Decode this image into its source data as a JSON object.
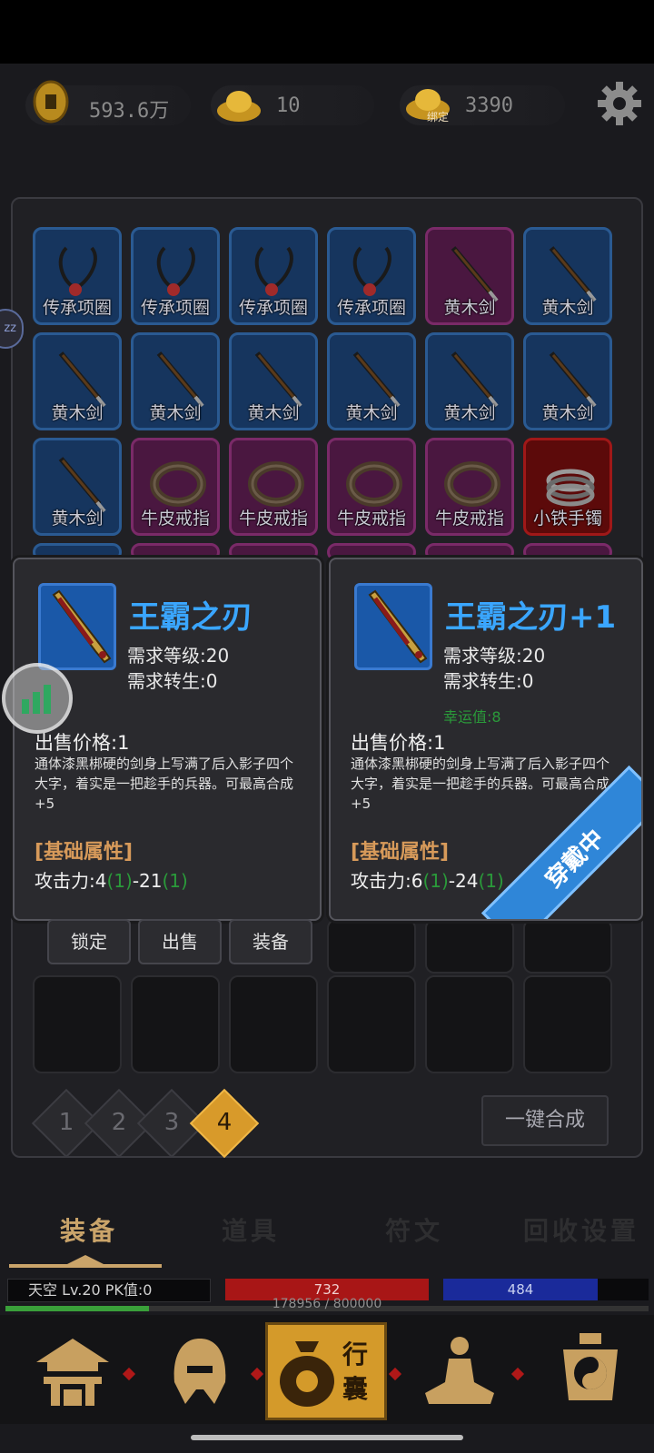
{
  "currency": {
    "copper": "593.6万",
    "gold": "10",
    "bound_gold": "3390",
    "bound_badge": "绑定"
  },
  "inventory": {
    "rows": [
      [
        {
          "label": "传承项圈",
          "color": "blue",
          "icon": "necklace-icon"
        },
        {
          "label": "传承项圈",
          "color": "blue",
          "icon": "necklace-icon"
        },
        {
          "label": "传承项圈",
          "color": "blue",
          "icon": "necklace-icon"
        },
        {
          "label": "传承项圈",
          "color": "blue",
          "icon": "necklace-icon"
        },
        {
          "label": "黄木剑",
          "color": "purple",
          "icon": "sword-icon"
        },
        {
          "label": "黄木剑",
          "color": "blue",
          "icon": "sword-icon"
        }
      ],
      [
        {
          "label": "黄木剑",
          "color": "blue",
          "icon": "sword-icon"
        },
        {
          "label": "黄木剑",
          "color": "blue",
          "icon": "sword-icon"
        },
        {
          "label": "黄木剑",
          "color": "blue",
          "icon": "sword-icon"
        },
        {
          "label": "黄木剑",
          "color": "blue",
          "icon": "sword-icon"
        },
        {
          "label": "黄木剑",
          "color": "blue",
          "icon": "sword-icon"
        },
        {
          "label": "黄木剑",
          "color": "blue",
          "icon": "sword-icon"
        }
      ],
      [
        {
          "label": "黄木剑",
          "color": "blue",
          "icon": "sword-icon"
        },
        {
          "label": "牛皮戒指",
          "color": "purple",
          "icon": "ring-icon"
        },
        {
          "label": "牛皮戒指",
          "color": "purple",
          "icon": "ring-icon"
        },
        {
          "label": "牛皮戒指",
          "color": "purple",
          "icon": "ring-icon"
        },
        {
          "label": "牛皮戒指",
          "color": "purple",
          "icon": "ring-icon"
        },
        {
          "label": "小铁手镯",
          "color": "red",
          "icon": "bracelet-icon"
        }
      ]
    ]
  },
  "item_new": {
    "name": "王霸之刃",
    "req_level": "需求等级:20",
    "req_rebirth": "需求转生:0",
    "price": "出售价格:1",
    "desc": "通体漆黑梆硬的剑身上写满了后入影子四个大字，着实是一把趁手的兵器。可最高合成+5",
    "attr_title": "[基础属性]",
    "attack_prefix": "攻击力:4",
    "attack_bonus1": "(1)",
    "attack_mid": "-21",
    "attack_bonus2": "(1)"
  },
  "item_worn": {
    "name": "王霸之刃+1",
    "req_level": "需求等级:20",
    "req_rebirth": "需求转生:0",
    "luck": "幸运值:8",
    "price": "出售价格:1",
    "desc": "通体漆黑梆硬的剑身上写满了后入影子四个大字，着实是一把趁手的兵器。可最高合成+5",
    "attr_title": "[基础属性]",
    "attack_prefix": "攻击力:6",
    "attack_bonus1": "(1)",
    "attack_mid": "-24",
    "attack_bonus2": "(1)",
    "badge": "穿戴中"
  },
  "actions": {
    "lock": "锁定",
    "sell": "出售",
    "equip": "装备"
  },
  "pages": [
    "1",
    "2",
    "3",
    "4"
  ],
  "active_page": "4",
  "merge_button": "一键合成",
  "tabs": [
    "装备",
    "道具",
    "符文",
    "回收设置"
  ],
  "player": {
    "info": "天空  Lv.20 PK值:0",
    "hp": "732",
    "mp": "484",
    "xp": "178956 / 800000",
    "xp_fraction": 0.2237
  },
  "nav": {
    "bag_label": "行囊"
  },
  "float_left": "zz"
}
